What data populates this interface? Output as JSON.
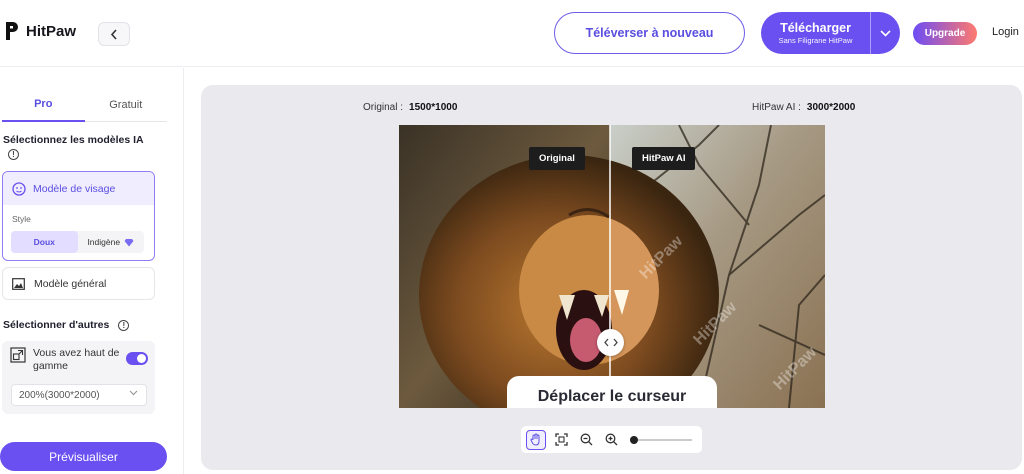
{
  "header": {
    "brand": "HitPaw",
    "reupload_label": "Téléverser à nouveau",
    "download_label": "Télécharger",
    "download_sub": "Sans Filigrane HitPaw",
    "upgrade_label": "Upgrade",
    "login_label": "Login"
  },
  "sidebar": {
    "tabs": [
      {
        "label": "Pro",
        "active": true
      },
      {
        "label": "Gratuit",
        "active": false
      }
    ],
    "ai_models_title": "Sélectionnez les modèles IA",
    "face_model": {
      "label": "Modèle de visage",
      "style_label": "Style",
      "styles": [
        {
          "label": "Doux",
          "active": true
        },
        {
          "label": "Indigène",
          "active": false
        }
      ]
    },
    "general_model": "Modèle général",
    "others_title": "Sélectionner d'autres",
    "high_end_label": "Vous avez haut de gamme",
    "high_end_enabled": true,
    "resolution_value": "200%(3000*2000)",
    "preview_label": "Prévisualiser"
  },
  "canvas": {
    "original_label": "Original :",
    "original_res": "1500*1000",
    "ai_label": "HitPaw AI :",
    "ai_res": "3000*2000",
    "tag_original": "Original",
    "tag_ai": "HitPaw AI",
    "drag_hint": "Déplacer le curseur",
    "watermark": "HitPaw",
    "slider_position": 0.49,
    "zoom_level": 0
  },
  "colors": {
    "accent": "#6a50f0",
    "accent_text": "#5a4ee0",
    "canvas_bg": "#e9e9ee"
  },
  "icons": [
    "hitpaw-logo-icon",
    "back-chevron-icon",
    "dropdown-chevron-icon",
    "info-icon",
    "face-icon",
    "diamond-icon",
    "image-icon",
    "resize-icon",
    "hand-icon",
    "crop-icon",
    "zoom-out-icon",
    "zoom-in-icon"
  ]
}
